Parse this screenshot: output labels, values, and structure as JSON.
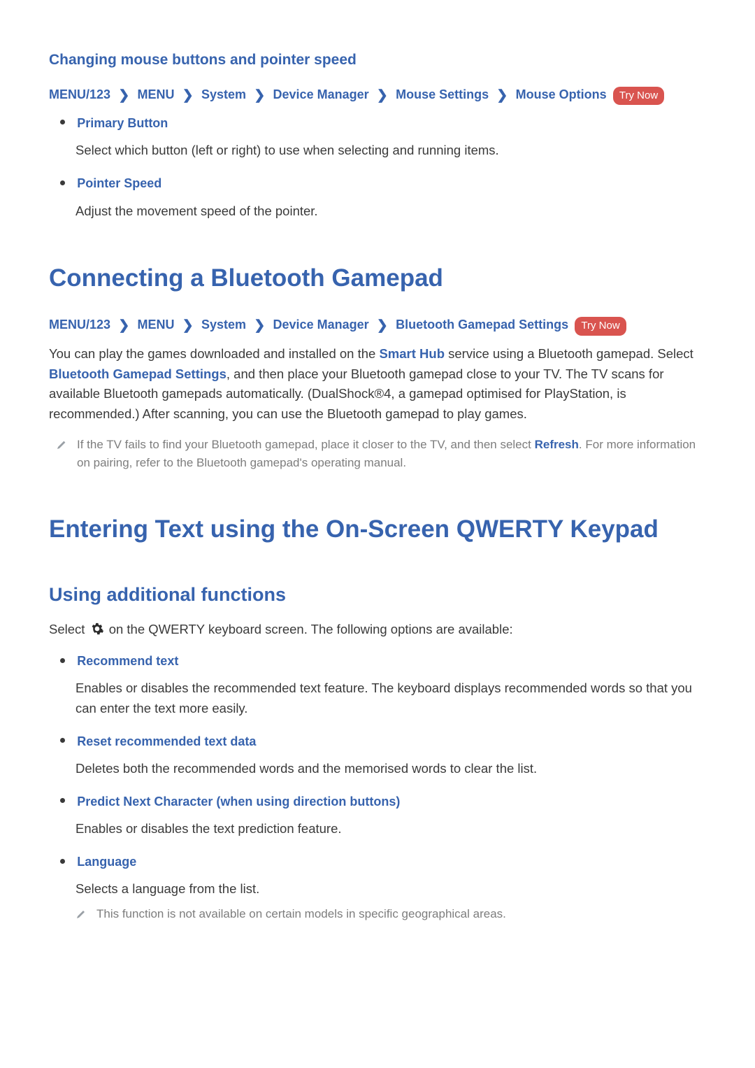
{
  "sec_mouse": {
    "subtitle": "Changing mouse buttons and pointer speed",
    "breadcrumb": [
      "MENU/123",
      "MENU",
      "System",
      "Device Manager",
      "Mouse Settings",
      "Mouse Options"
    ],
    "trynow": "Try Now",
    "items": [
      {
        "title": "Primary Button",
        "desc": "Select which button (left or right) to use when selecting and running items."
      },
      {
        "title": "Pointer Speed",
        "desc": "Adjust the movement speed of the pointer."
      }
    ]
  },
  "sec_gamepad": {
    "title": "Connecting a Bluetooth Gamepad",
    "breadcrumb": [
      "MENU/123",
      "MENU",
      "System",
      "Device Manager",
      "Bluetooth Gamepad Settings"
    ],
    "trynow": "Try Now",
    "para_pre": "You can play the games downloaded and installed on the ",
    "smart_hub": "Smart Hub",
    "para_mid": " service using a Bluetooth gamepad. Select ",
    "bt_settings": "Bluetooth Gamepad Settings",
    "para_post": ", and then place your Bluetooth gamepad close to your TV. The TV scans for available Bluetooth gamepads automatically. (DualShock®4, a gamepad optimised for PlayStation, is recommended.) After scanning, you can use the Bluetooth gamepad to play games.",
    "note_pre": "If the TV fails to find your Bluetooth gamepad, place it closer to the TV, and then select ",
    "refresh": "Refresh",
    "note_post": ". For more information on pairing, refer to the Bluetooth gamepad's operating manual."
  },
  "sec_qwerty": {
    "title": "Entering Text using the On-Screen QWERTY Keypad",
    "subtitle": "Using additional functions",
    "intro_pre": "Select ",
    "intro_post": " on the QWERTY keyboard screen. The following options are available:",
    "items": [
      {
        "title": "Recommend text",
        "desc": "Enables or disables the recommended text feature. The keyboard displays recommended words so that you can enter the text more easily."
      },
      {
        "title": "Reset recommended text data",
        "desc": "Deletes both the recommended words and the memorised words to clear the list."
      },
      {
        "title": "Predict Next Character (when using direction buttons)",
        "desc": "Enables or disables the text prediction feature."
      },
      {
        "title": "Language",
        "desc": "Selects a language from the list.",
        "note": "This function is not available on certain models in specific geographical areas."
      }
    ]
  }
}
